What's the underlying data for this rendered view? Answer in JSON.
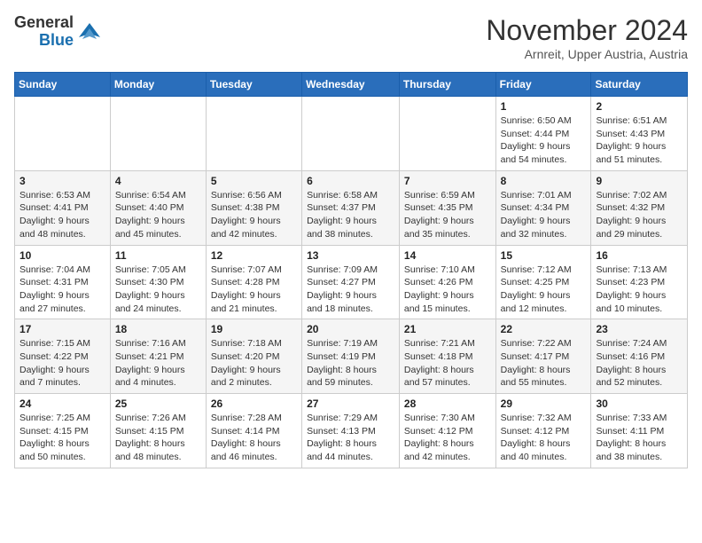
{
  "logo": {
    "text_general": "General",
    "text_blue": "Blue",
    "arrow_color": "#1a6faf"
  },
  "title": "November 2024",
  "location": "Arnreit, Upper Austria, Austria",
  "weekdays": [
    "Sunday",
    "Monday",
    "Tuesday",
    "Wednesday",
    "Thursday",
    "Friday",
    "Saturday"
  ],
  "weeks": [
    [
      {
        "day": "",
        "info": ""
      },
      {
        "day": "",
        "info": ""
      },
      {
        "day": "",
        "info": ""
      },
      {
        "day": "",
        "info": ""
      },
      {
        "day": "",
        "info": ""
      },
      {
        "day": "1",
        "info": "Sunrise: 6:50 AM\nSunset: 4:44 PM\nDaylight: 9 hours\nand 54 minutes."
      },
      {
        "day": "2",
        "info": "Sunrise: 6:51 AM\nSunset: 4:43 PM\nDaylight: 9 hours\nand 51 minutes."
      }
    ],
    [
      {
        "day": "3",
        "info": "Sunrise: 6:53 AM\nSunset: 4:41 PM\nDaylight: 9 hours\nand 48 minutes."
      },
      {
        "day": "4",
        "info": "Sunrise: 6:54 AM\nSunset: 4:40 PM\nDaylight: 9 hours\nand 45 minutes."
      },
      {
        "day": "5",
        "info": "Sunrise: 6:56 AM\nSunset: 4:38 PM\nDaylight: 9 hours\nand 42 minutes."
      },
      {
        "day": "6",
        "info": "Sunrise: 6:58 AM\nSunset: 4:37 PM\nDaylight: 9 hours\nand 38 minutes."
      },
      {
        "day": "7",
        "info": "Sunrise: 6:59 AM\nSunset: 4:35 PM\nDaylight: 9 hours\nand 35 minutes."
      },
      {
        "day": "8",
        "info": "Sunrise: 7:01 AM\nSunset: 4:34 PM\nDaylight: 9 hours\nand 32 minutes."
      },
      {
        "day": "9",
        "info": "Sunrise: 7:02 AM\nSunset: 4:32 PM\nDaylight: 9 hours\nand 29 minutes."
      }
    ],
    [
      {
        "day": "10",
        "info": "Sunrise: 7:04 AM\nSunset: 4:31 PM\nDaylight: 9 hours\nand 27 minutes."
      },
      {
        "day": "11",
        "info": "Sunrise: 7:05 AM\nSunset: 4:30 PM\nDaylight: 9 hours\nand 24 minutes."
      },
      {
        "day": "12",
        "info": "Sunrise: 7:07 AM\nSunset: 4:28 PM\nDaylight: 9 hours\nand 21 minutes."
      },
      {
        "day": "13",
        "info": "Sunrise: 7:09 AM\nSunset: 4:27 PM\nDaylight: 9 hours\nand 18 minutes."
      },
      {
        "day": "14",
        "info": "Sunrise: 7:10 AM\nSunset: 4:26 PM\nDaylight: 9 hours\nand 15 minutes."
      },
      {
        "day": "15",
        "info": "Sunrise: 7:12 AM\nSunset: 4:25 PM\nDaylight: 9 hours\nand 12 minutes."
      },
      {
        "day": "16",
        "info": "Sunrise: 7:13 AM\nSunset: 4:23 PM\nDaylight: 9 hours\nand 10 minutes."
      }
    ],
    [
      {
        "day": "17",
        "info": "Sunrise: 7:15 AM\nSunset: 4:22 PM\nDaylight: 9 hours\nand 7 minutes."
      },
      {
        "day": "18",
        "info": "Sunrise: 7:16 AM\nSunset: 4:21 PM\nDaylight: 9 hours\nand 4 minutes."
      },
      {
        "day": "19",
        "info": "Sunrise: 7:18 AM\nSunset: 4:20 PM\nDaylight: 9 hours\nand 2 minutes."
      },
      {
        "day": "20",
        "info": "Sunrise: 7:19 AM\nSunset: 4:19 PM\nDaylight: 8 hours\nand 59 minutes."
      },
      {
        "day": "21",
        "info": "Sunrise: 7:21 AM\nSunset: 4:18 PM\nDaylight: 8 hours\nand 57 minutes."
      },
      {
        "day": "22",
        "info": "Sunrise: 7:22 AM\nSunset: 4:17 PM\nDaylight: 8 hours\nand 55 minutes."
      },
      {
        "day": "23",
        "info": "Sunrise: 7:24 AM\nSunset: 4:16 PM\nDaylight: 8 hours\nand 52 minutes."
      }
    ],
    [
      {
        "day": "24",
        "info": "Sunrise: 7:25 AM\nSunset: 4:15 PM\nDaylight: 8 hours\nand 50 minutes."
      },
      {
        "day": "25",
        "info": "Sunrise: 7:26 AM\nSunset: 4:15 PM\nDaylight: 8 hours\nand 48 minutes."
      },
      {
        "day": "26",
        "info": "Sunrise: 7:28 AM\nSunset: 4:14 PM\nDaylight: 8 hours\nand 46 minutes."
      },
      {
        "day": "27",
        "info": "Sunrise: 7:29 AM\nSunset: 4:13 PM\nDaylight: 8 hours\nand 44 minutes."
      },
      {
        "day": "28",
        "info": "Sunrise: 7:30 AM\nSunset: 4:12 PM\nDaylight: 8 hours\nand 42 minutes."
      },
      {
        "day": "29",
        "info": "Sunrise: 7:32 AM\nSunset: 4:12 PM\nDaylight: 8 hours\nand 40 minutes."
      },
      {
        "day": "30",
        "info": "Sunrise: 7:33 AM\nSunset: 4:11 PM\nDaylight: 8 hours\nand 38 minutes."
      }
    ]
  ]
}
